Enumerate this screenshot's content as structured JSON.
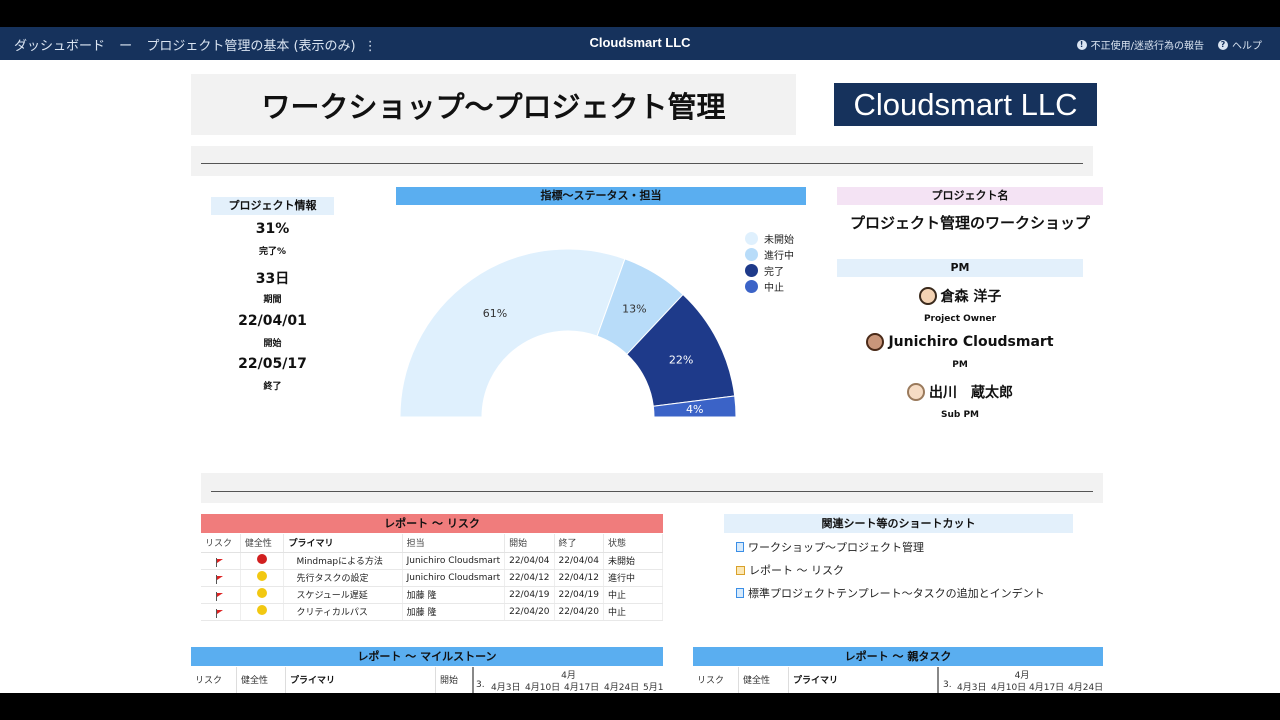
{
  "topbar": {
    "breadcrumb_home": "ダッシュボード",
    "breadcrumb_sep": "ー",
    "breadcrumb_current": "プロジェクト管理の基本 (表示のみ)",
    "menu_glyph": "⋮",
    "brand": "Cloudsmart LLC",
    "report_abuse": "不正使用/迷惑行為の報告",
    "help": "ヘルプ"
  },
  "header": {
    "title": "ワークショップ〜プロジェクト管理",
    "logo_text": "Cloudsmart LLC"
  },
  "project_info": {
    "heading": "プロジェクト情報",
    "complete_value": "31%",
    "complete_label": "完了%",
    "duration_value": "33日",
    "duration_label": "期間",
    "start_value": "22/04/01",
    "start_label": "開始",
    "end_value": "22/05/17",
    "end_label": "終了"
  },
  "status_chart": {
    "heading": "指標〜ステータス・担当",
    "legend": [
      {
        "label": "未開始",
        "color": "#dff0fd"
      },
      {
        "label": "進行中",
        "color": "#b8dcf9"
      },
      {
        "label": "完了",
        "color": "#1e3a8a"
      },
      {
        "label": "中止",
        "color": "#3b63c7"
      }
    ]
  },
  "chart_data": {
    "type": "pie",
    "categories": [
      "未開始",
      "進行中",
      "完了",
      "中止"
    ],
    "values": [
      61,
      13,
      22,
      4
    ],
    "data_labels": [
      "61%",
      "13%",
      "22%",
      "4%"
    ],
    "colors": [
      "#dff0fd",
      "#b8dcf9",
      "#1e3a8a",
      "#3b63c7"
    ],
    "title": "指標〜ステータス・担当",
    "legend_position": "right"
  },
  "project_name": {
    "heading": "プロジェクト名",
    "value": "プロジェクト管理のワークショップ"
  },
  "pm": {
    "heading": "PM",
    "people": [
      {
        "name": "倉森 洋子",
        "role": "Project Owner"
      },
      {
        "name": "Junichiro Cloudsmart",
        "role": "PM"
      },
      {
        "name": "出川　蔵太郎",
        "role": "Sub PM"
      }
    ]
  },
  "risk_report": {
    "heading": "レポート 〜 リスク",
    "columns": [
      "リスク",
      "健全性",
      "プライマリ",
      "担当",
      "開始",
      "終了",
      "状態"
    ],
    "rows": [
      {
        "health": "#d11f1f",
        "primary": "Mindmapによる方法",
        "owner": "Junichiro Cloudsmart",
        "start": "22/04/04",
        "end": "22/04/04",
        "status": "未開始"
      },
      {
        "health": "#f2c811",
        "primary": "先行タスクの設定",
        "owner": "Junichiro Cloudsmart",
        "start": "22/04/12",
        "end": "22/04/12",
        "status": "進行中"
      },
      {
        "health": "#f2c811",
        "primary": "スケジュール遅延",
        "owner": "加藤 隆",
        "start": "22/04/19",
        "end": "22/04/19",
        "status": "中止"
      },
      {
        "health": "#f2c811",
        "primary": "クリティカルパス",
        "owner": "加藤 隆",
        "start": "22/04/20",
        "end": "22/04/20",
        "status": "中止"
      }
    ]
  },
  "shortcuts": {
    "heading": "関連シート等のショートカット",
    "links": [
      "ワークショップ〜プロジェクト管理",
      "レポート 〜 リスク",
      "標準プロジェクトテンプレート〜タスクの追加とインデント"
    ]
  },
  "milestone_report": {
    "heading": "レポート 〜 マイルストーン",
    "col_risk": "リスク",
    "col_health": "健全性",
    "col_primary": "プライマリ",
    "col_start": "開始",
    "month": "4月",
    "weeks": [
      "3.",
      "4月3日",
      "4月10日",
      "4月17日",
      "4月24日",
      "5月1"
    ]
  },
  "parent_task_report": {
    "heading": "レポート 〜 親タスク",
    "col_risk": "リスク",
    "col_health": "健全性",
    "col_primary": "プライマリ",
    "month": "4月",
    "weeks": [
      "3.",
      "4月3日",
      "4月10日",
      "4月17日",
      "4月24日"
    ]
  }
}
